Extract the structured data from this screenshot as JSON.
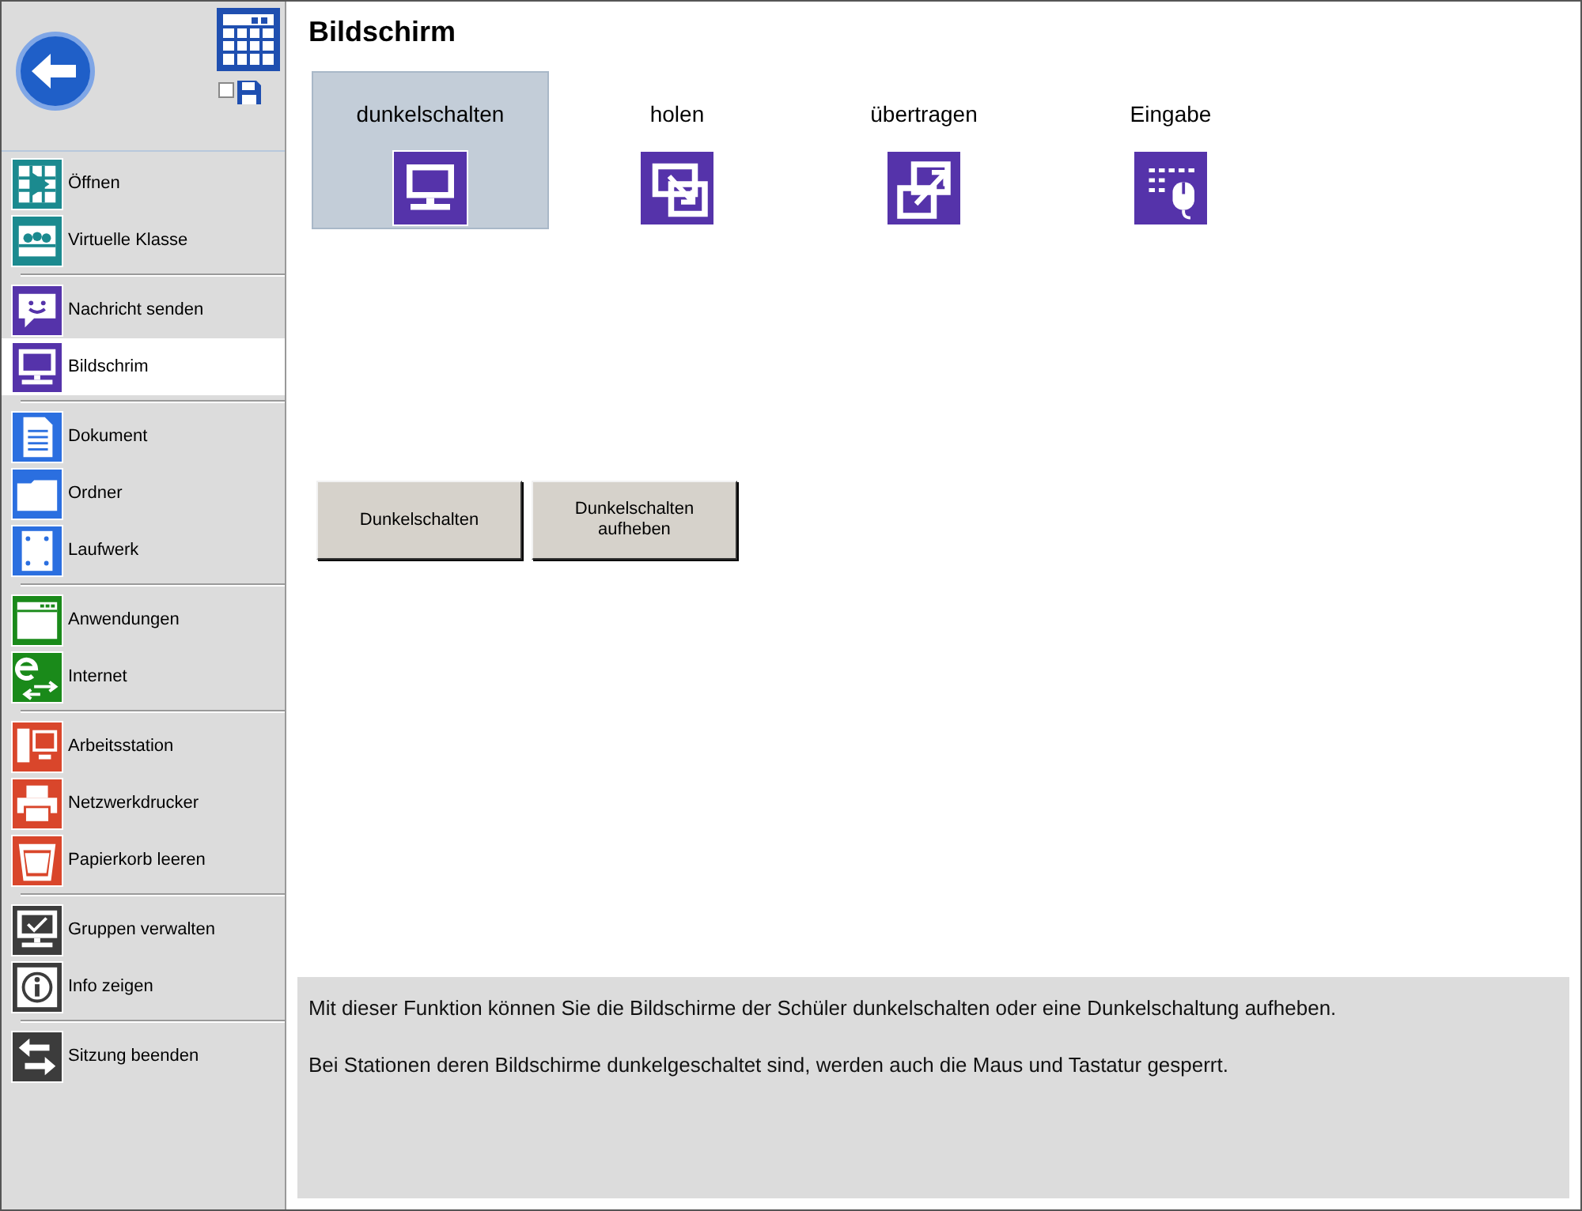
{
  "sidebar": {
    "save_checkbox": {
      "checked": false
    },
    "groups": [
      {
        "color": "#1b8a8f",
        "items": [
          {
            "kind": "open",
            "label": "Öffnen",
            "selected": false
          },
          {
            "kind": "class",
            "label": "Virtuelle Klasse",
            "selected": false
          }
        ]
      },
      {
        "color": "#5533aa",
        "items": [
          {
            "kind": "message",
            "label": "Nachricht senden",
            "selected": false
          },
          {
            "kind": "monitor",
            "label": "Bildschrim",
            "selected": true
          }
        ]
      },
      {
        "color": "#2b6fe0",
        "items": [
          {
            "kind": "document",
            "label": "Dokument",
            "selected": false
          },
          {
            "kind": "folder",
            "label": "Ordner",
            "selected": false
          },
          {
            "kind": "drive",
            "label": "Laufwerk",
            "selected": false
          }
        ]
      },
      {
        "color": "#1a8a1a",
        "items": [
          {
            "kind": "window",
            "label": "Anwendungen",
            "selected": false
          },
          {
            "kind": "internet",
            "label": "Internet",
            "selected": false
          }
        ]
      },
      {
        "color": "#d9462b",
        "items": [
          {
            "kind": "workstation",
            "label": "Arbeitsstation",
            "selected": false
          },
          {
            "kind": "printer",
            "label": "Netzwerkdrucker",
            "selected": false
          },
          {
            "kind": "bin",
            "label": "Papierkorb leeren",
            "selected": false
          }
        ]
      },
      {
        "color": "#3c3c3c",
        "items": [
          {
            "kind": "check",
            "label": "Gruppen verwalten",
            "selected": false
          },
          {
            "kind": "info",
            "label": "Info zeigen",
            "selected": false
          }
        ]
      },
      {
        "color": "#3c3c3c",
        "items": [
          {
            "kind": "swap",
            "label": "Sitzung beenden",
            "selected": false
          }
        ]
      }
    ]
  },
  "title": "Bildschirm",
  "tiles": [
    {
      "kind": "monitor",
      "label": "dunkelschalten",
      "selected": true
    },
    {
      "kind": "fetch",
      "label": "holen",
      "selected": false
    },
    {
      "kind": "send",
      "label": "übertragen",
      "selected": false
    },
    {
      "kind": "input",
      "label": "Eingabe",
      "selected": false
    }
  ],
  "buttons": [
    "Dunkelschalten",
    "Dunkelschalten aufheben"
  ],
  "info": [
    "Mit dieser Funktion können Sie die Bildschirme der Schüler dunkelschalten oder eine Dunkelschaltung aufheben.",
    "Bei Stationen deren Bildschirme dunkelgeschaltet sind, werden auch die Maus und Tastatur gesperrt."
  ]
}
